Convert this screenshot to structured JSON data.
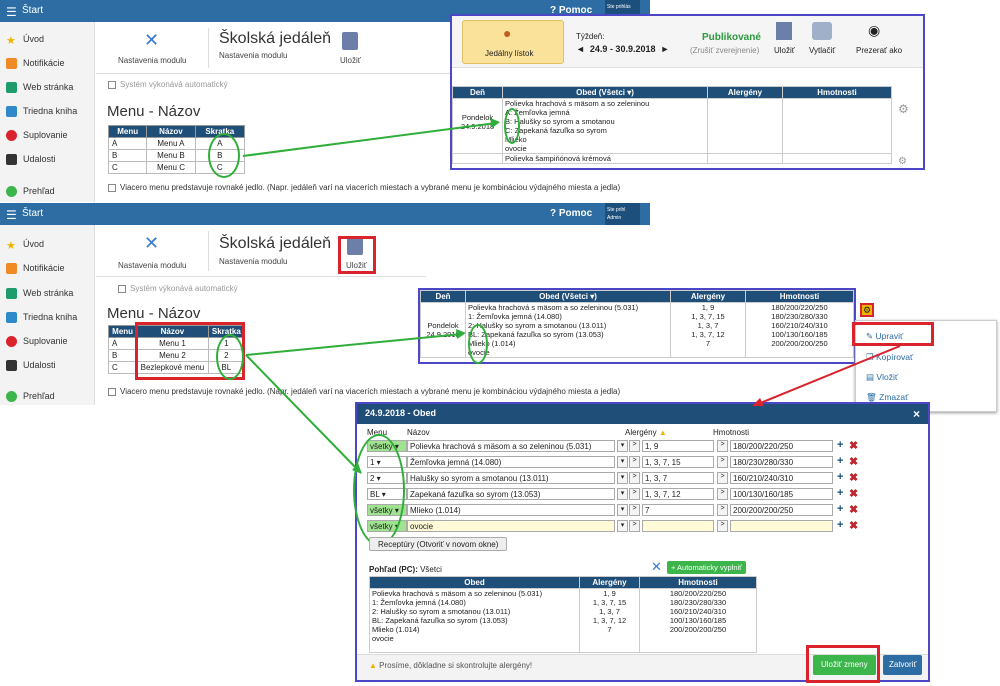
{
  "nav": {
    "start": "Štart",
    "help": "Pomoc",
    "user_top": "Ste prihlás",
    "user_bot_1": "Ste prihl",
    "user_bot_2": "Admin"
  },
  "sidebar": [
    "Úvod",
    "Notifikácie",
    "Web stránka",
    "Triedna kniha",
    "Suplovanie",
    "Udalosti",
    "Prehľad"
  ],
  "module": {
    "settings": "Nastavenia modulu",
    "title": "Školská jedáleň",
    "subtitle": "Nastavenia modulu",
    "save": "Uložiť",
    "auto": "Systém výkonává automatický"
  },
  "menu_heading": "Menu - Názov",
  "menu_table_headers": [
    "Menu",
    "Názov",
    "Skratka"
  ],
  "menu_table_top": [
    [
      "A",
      "Menu A",
      "A"
    ],
    [
      "B",
      "Menu B",
      "B"
    ],
    [
      "C",
      "Menu C",
      "C"
    ]
  ],
  "menu_table_bottom": [
    [
      "A",
      "Menu 1",
      "1"
    ],
    [
      "B",
      "Menu 2",
      "2"
    ],
    [
      "C",
      "Bezlepkové menu",
      "BL"
    ]
  ],
  "multi_note": "Viacero menu predstavuje rovnaké jedlo. (Napr. jedáleň varí na viacerích miestach a vybrané menu je kombináciou výdajného miesta a jedla)",
  "top_panel": {
    "jedalny": "Jedálny lístok",
    "tyzden": "Týždeň:",
    "range": "24.9 - 30.9.2018",
    "status": "Publikované",
    "unpublish": "(Zrušiť zverejnenie)",
    "save": "Uložiť",
    "print": "Vytlačiť",
    "view": "Prezerať ako",
    "headers": [
      "Deň",
      "Obed (Všetci ▾)",
      "Alergény",
      "Hmotnosti"
    ],
    "day": "Pondelok\n24.9.2018",
    "obed_lines": [
      "Polievka hrachová s mäsom a so zeleninou",
      "A: Žemľovka jemná",
      "B: Halušky so syrom a smotanou",
      "C: Zapekaná fazuľka so syrom",
      "Mlieko",
      "ovocie"
    ],
    "next": "Polievka šampiňónová krémová"
  },
  "mid_panel": {
    "headers": [
      "Deň",
      "Obed (Všetci ▾)",
      "Alergény",
      "Hmotnosti"
    ],
    "day": "Pondelok\n24.9.2018",
    "obed_lines": [
      "Polievka hrachová s mäsom a so zeleninou (5.031)",
      "1: Žemľovka jemná (14.080)",
      "2: Halušky so syrom a smotanou (13.011)",
      "BL: Zapekaná fazuľka so syrom (13.053)",
      "Mlieko (1.014)",
      "ovocie"
    ],
    "alergeny": [
      "1, 9",
      "1, 3, 7, 15",
      "1, 3, 7",
      "1, 3, 7, 12",
      "7",
      ""
    ],
    "hmotnosti": [
      "180/200/220/250",
      "180/230/280/330",
      "160/210/240/310",
      "100/130/160/185",
      "200/200/200/250",
      ""
    ]
  },
  "context_menu": [
    "Upraviť",
    "Kopírovať",
    "Vložiť",
    "Zmazať"
  ],
  "dialog": {
    "title": "24.9.2018 - Obed",
    "close": "×",
    "col_menu": "Menu",
    "col_nazov": "Názov",
    "col_alergeny": "Alergény",
    "col_hmotnosti": "Hmotnosti",
    "rows": [
      {
        "menu": "všetky",
        "nazov": "Polievka hrachová s mäsom a so zeleninou (5.031)",
        "alergeny": "1, 9",
        "hmotnosti": "180/200/220/250"
      },
      {
        "menu": "1",
        "nazov": "Žemľovka jemná (14.080)",
        "alergeny": "1, 3, 7, 15",
        "hmotnosti": "180/230/280/330"
      },
      {
        "menu": "2",
        "nazov": "Halušky so syrom a smotanou (13.011)",
        "alergeny": "1, 3, 7",
        "hmotnosti": "160/210/240/310"
      },
      {
        "menu": "BL",
        "nazov": "Zapekaná fazuľka so syrom (13.053)",
        "alergeny": "1, 3, 7, 12",
        "hmotnosti": "100/130/160/185"
      },
      {
        "menu": "všetky",
        "nazov": "Mlieko (1.014)",
        "alergeny": "7",
        "hmotnosti": "200/200/200/250"
      },
      {
        "menu": "všetky",
        "nazov": "ovocie",
        "alergeny": "",
        "hmotnosti": ""
      }
    ],
    "receptury": "Receptúry (Otvoriť v novom okne)",
    "pohlad": "Pohľad (PC):",
    "pohlad_val": "Všetci",
    "auto_fill": "+ Automaticky vyplniť",
    "preview_headers": [
      "Obed",
      "Alergény",
      "Hmotnosti"
    ],
    "warning": "Prosíme, dôkladne si skontrolujte alergény!",
    "save_changes": "Uložiť zmeny",
    "close_btn": "Zatvoriť"
  }
}
